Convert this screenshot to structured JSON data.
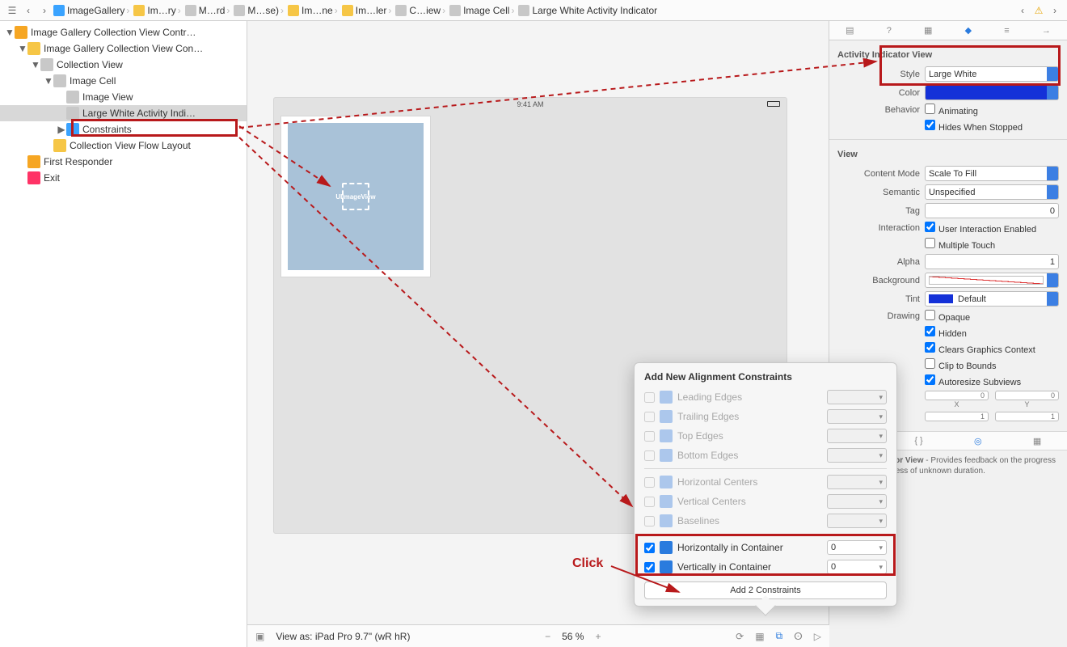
{
  "breadcrumb": {
    "items": [
      "ImageGallery",
      "Im…ry",
      "M…rd",
      "M…se)",
      "Im…ne",
      "Im…ler",
      "C…iew",
      "Image Cell",
      "Large White Activity Indicator"
    ]
  },
  "tree": {
    "items": [
      {
        "indent": 0,
        "tw": "▼",
        "icon": "orange",
        "label": "Image Gallery Collection View Contr…"
      },
      {
        "indent": 1,
        "tw": "▼",
        "icon": "yellow",
        "label": "Image Gallery Collection View Con…"
      },
      {
        "indent": 2,
        "tw": "▼",
        "icon": "gray",
        "label": "Collection View"
      },
      {
        "indent": 3,
        "tw": "▼",
        "icon": "gray",
        "label": "Image Cell"
      },
      {
        "indent": 4,
        "tw": "",
        "icon": "gray",
        "label": "Image View"
      },
      {
        "indent": 4,
        "tw": "",
        "icon": "gray",
        "label": "Large White Activity Indi…",
        "selected": true
      },
      {
        "indent": 4,
        "tw": "▶",
        "icon": "blue",
        "label": "Constraints"
      },
      {
        "indent": 3,
        "tw": "",
        "icon": "yellow",
        "label": "Collection View Flow Layout"
      },
      {
        "indent": 1,
        "tw": "",
        "icon": "orange",
        "label": "First Responder"
      },
      {
        "indent": 1,
        "tw": "",
        "icon": "red",
        "label": "Exit"
      }
    ]
  },
  "canvas": {
    "time": "9:41 AM",
    "spinner_label": "UIImageView"
  },
  "bottombar": {
    "view_as": "View as: iPad Pro 9.7\" (wR hR)",
    "zoom": "56 %"
  },
  "inspector": {
    "activity": {
      "title": "Activity Indicator View",
      "style_label": "Style",
      "style": "Large White",
      "color_label": "Color",
      "behavior_label": "Behavior",
      "animating": "Animating",
      "hides": "Hides When Stopped"
    },
    "view": {
      "title": "View",
      "content_mode_label": "Content Mode",
      "content_mode": "Scale To Fill",
      "semantic_label": "Semantic",
      "semantic": "Unspecified",
      "tag_label": "Tag",
      "tag": "0",
      "interaction_label": "Interaction",
      "uie": "User Interaction Enabled",
      "mtouch": "Multiple Touch",
      "alpha_label": "Alpha",
      "alpha": "1",
      "bg_label": "Background",
      "tint_label": "Tint",
      "tint": "Default",
      "drawing_label": "Drawing",
      "d_opaque": "Opaque",
      "d_hidden": "Hidden",
      "d_clears": "Clears Graphics Context",
      "d_clip": "Clip to Bounds",
      "d_autoresize": "Autoresize Subviews",
      "x": "0",
      "y": "0",
      "xl": "X",
      "yl": "Y",
      "w": "1",
      "h": "1"
    },
    "help": {
      "title": "Activity Indicator View",
      "text": " - Provides feedback on the progress of a task or process of unknown duration."
    }
  },
  "popover": {
    "title": "Add New Alignment Constraints",
    "rows": [
      {
        "label": "Leading Edges",
        "checked": false,
        "enabled": false,
        "val": ""
      },
      {
        "label": "Trailing Edges",
        "checked": false,
        "enabled": false,
        "val": ""
      },
      {
        "label": "Top Edges",
        "checked": false,
        "enabled": false,
        "val": ""
      },
      {
        "label": "Bottom Edges",
        "checked": false,
        "enabled": false,
        "val": ""
      },
      {
        "label": "Horizontal Centers",
        "checked": false,
        "enabled": false,
        "val": ""
      },
      {
        "label": "Vertical Centers",
        "checked": false,
        "enabled": false,
        "val": ""
      },
      {
        "label": "Baselines",
        "checked": false,
        "enabled": false,
        "val": ""
      },
      {
        "label": "Horizontally in Container",
        "checked": true,
        "enabled": true,
        "val": "0"
      },
      {
        "label": "Vertically in Container",
        "checked": true,
        "enabled": true,
        "val": "0"
      }
    ],
    "button": "Add 2 Constraints"
  },
  "annotation": {
    "click": "Click"
  }
}
